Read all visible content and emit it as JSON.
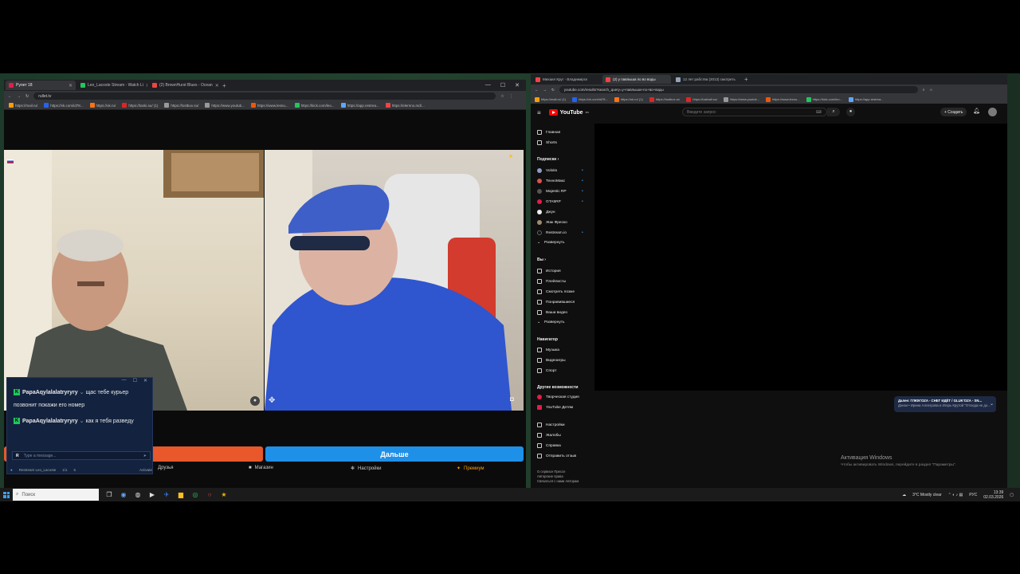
{
  "left_browser": {
    "tabs": [
      {
        "label": "Рулет 18",
        "color": "#e11d48",
        "active": true
      },
      {
        "label": "Leo_Lacoste Stream - Watch Li",
        "color": "#22c55e",
        "active": false
      },
      {
        "label": "(2) BrownHurst Blues - Ocean",
        "color": "#ef4444",
        "active": false
      }
    ],
    "url": "rullet.tv",
    "bookmarks": [
      "https://mail.ru/",
      "https://vk.com/id78...",
      "https://ok.ru/",
      "https://tanki.su/ (1)",
      "https://lostbox.su/",
      "https://www.youtub...",
      "https://www.lesnu...",
      "https://kick.com/leo...",
      "https://app.restrea...",
      "https://elernno.md/..."
    ]
  },
  "chat": {
    "messages": [
      {
        "user": "PapaAqylalalatryryry",
        "text": "щас тебе курьер позвонит покажи его номер"
      },
      {
        "user": "PapaAqylalalatryryry",
        "text": "как я тебя разведу"
      }
    ],
    "input_placeholder": "Type a message...",
    "footer_channel": "Restream Leo_Lacoste",
    "footer_count": "1/1",
    "footer_count2": "5",
    "footer_btn": "Activate"
  },
  "controls": {
    "next_label": "Дальше",
    "nav": [
      {
        "label": "Друзья",
        "icon": "friends-icon"
      },
      {
        "label": "Магазин",
        "icon": "shop-icon"
      },
      {
        "label": "Настройки",
        "icon": "gear-icon"
      },
      {
        "label": "Премиум",
        "icon": "premium-icon"
      }
    ]
  },
  "right_browser": {
    "tabs": [
      {
        "label": "Михаил Круг - Владимирск",
        "active": false
      },
      {
        "label": "(2) у павлыша по во воды",
        "active": true
      },
      {
        "label": "12 лет рабства (2013) смотреть",
        "active": false
      }
    ],
    "url": "youtube.com/results?search_query=у+павлыша+по+во+воды",
    "bookmarks": [
      "https://mail.ru/ (1)",
      "https://vk.com/id78...",
      "https://ok.ru/ (1)",
      "https://lostbox.ru/",
      "https://lostbali.su/",
      "https://www.youtub...",
      "https://www.lesnu...",
      "https://kick.com/leo...",
      "https://app.restrea..."
    ]
  },
  "youtube": {
    "logo": "YouTube",
    "logo_sup": "RU",
    "search_placeholder": "Введите запрос",
    "create_label": "+ Создать",
    "sidebar": {
      "main": [
        {
          "label": "Главная",
          "icon": "home-icon"
        },
        {
          "label": "Shorts",
          "icon": "shorts-icon"
        }
      ],
      "subs_title": "Подписки",
      "subs": [
        "Voloks",
        "ТехноМакс",
        "Majestic RP",
        "GTA5RP",
        "Джун",
        "Жак Фреско",
        "Restream.io",
        "Развернуть"
      ],
      "you_title": "Вы",
      "you": [
        {
          "label": "История",
          "icon": "history-icon"
        },
        {
          "label": "Плейлисты",
          "icon": "playlist-icon"
        },
        {
          "label": "Смотреть позже",
          "icon": "watch-later-icon"
        },
        {
          "label": "Понравившиеся",
          "icon": "like-icon"
        },
        {
          "label": "Ваши видео",
          "icon": "your-videos-icon"
        },
        {
          "label": "Развернуть",
          "icon": "chevron-down-icon"
        }
      ],
      "nav_title": "Навигатор",
      "nav": [
        {
          "label": "Музыка",
          "icon": "music-icon"
        },
        {
          "label": "Видеоигры",
          "icon": "gaming-icon"
        },
        {
          "label": "Спорт",
          "icon": "sport-icon"
        }
      ],
      "more_title": "Другие возможности",
      "more": [
        {
          "label": "Творческая студия",
          "icon": "studio-icon"
        },
        {
          "label": "YouTube Детям",
          "icon": "kids-icon"
        }
      ],
      "settings": [
        {
          "label": "Настройки",
          "icon": "gear-icon"
        },
        {
          "label": "Жалобы",
          "icon": "flag-icon"
        },
        {
          "label": "Справка",
          "icon": "help-icon"
        },
        {
          "label": "Отправить отзыв",
          "icon": "feedback-icon"
        }
      ],
      "footer": [
        "О сервисе  Прессе",
        "Авторские права",
        "Связаться с нами  Авторам"
      ]
    },
    "toast_title": "Далее: ГЛЮК'OZA - СНЕГ ИДЁТ / GLUK'OZA - SN...",
    "toast_sub": "Дэнзи • Ирина Аллегрова и Игорь Крутой \"Отсюда не до...",
    "activation_title": "Активация Windows",
    "activation_sub": "Чтобы активировать Windows, перейдите в раздел \"Параметры\"."
  },
  "taskbar": {
    "search_placeholder": "Поиск",
    "weather": "3°C  Mostly clear",
    "lang": "РУС",
    "time": "13:39",
    "date": "02.03.2026"
  }
}
